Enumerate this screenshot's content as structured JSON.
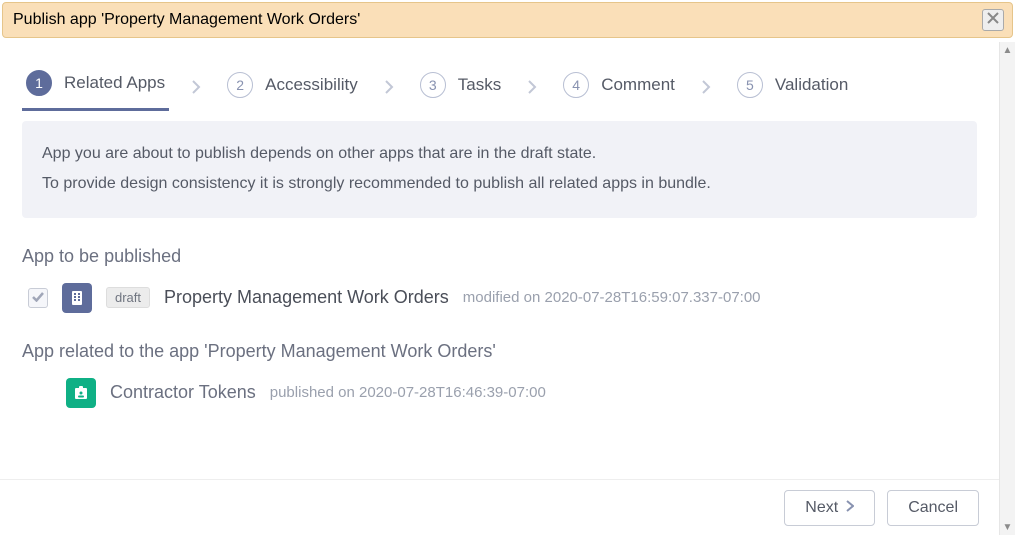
{
  "header": {
    "title": "Publish app 'Property Management Work Orders'"
  },
  "steps": [
    {
      "num": "1",
      "label": "Related Apps"
    },
    {
      "num": "2",
      "label": "Accessibility"
    },
    {
      "num": "3",
      "label": "Tasks"
    },
    {
      "num": "4",
      "label": "Comment"
    },
    {
      "num": "5",
      "label": "Validation"
    }
  ],
  "info": {
    "line1": "App you are about to publish depends on other apps that are in the draft state.",
    "line2": "To provide design consistency it is strongly recommended to publish all related apps in bundle."
  },
  "sections": {
    "to_publish_title": "App to be published",
    "related_title": "App related to the app 'Property Management Work Orders'"
  },
  "app_to_publish": {
    "badge": "draft",
    "name": "Property Management Work Orders",
    "meta": "modified on 2020-07-28T16:59:07.337-07:00"
  },
  "related_app": {
    "name": "Contractor Tokens",
    "meta": "published on 2020-07-28T16:46:39-07:00"
  },
  "footer": {
    "next": "Next",
    "cancel": "Cancel"
  }
}
